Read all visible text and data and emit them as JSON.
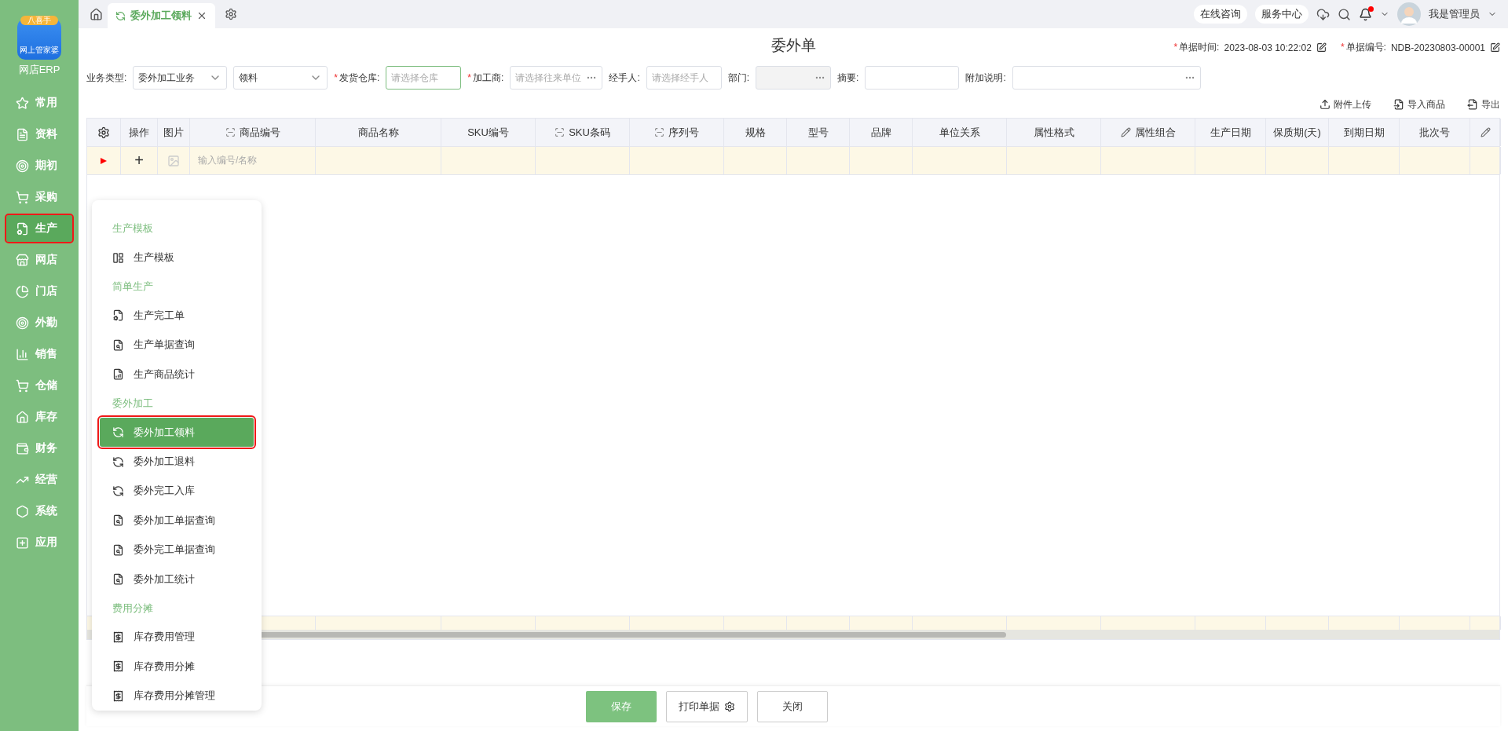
{
  "app": {
    "logo_badge": "八喜手",
    "logo_caption": "网上管家婆",
    "name": "网店ERP"
  },
  "sidebar": {
    "items": [
      {
        "label": "常用",
        "selected": false,
        "highlighted": false
      },
      {
        "label": "资料",
        "selected": false,
        "highlighted": false
      },
      {
        "label": "期初",
        "selected": false,
        "highlighted": false
      },
      {
        "label": "采购",
        "selected": false,
        "highlighted": false
      },
      {
        "label": "生产",
        "selected": true,
        "highlighted": true
      },
      {
        "label": "网店",
        "selected": false,
        "highlighted": false
      },
      {
        "label": "门店",
        "selected": false,
        "highlighted": false
      },
      {
        "label": "外勤",
        "selected": false,
        "highlighted": false
      },
      {
        "label": "销售",
        "selected": false,
        "highlighted": false
      },
      {
        "label": "仓储",
        "selected": false,
        "highlighted": false
      },
      {
        "label": "库存",
        "selected": false,
        "highlighted": false
      },
      {
        "label": "财务",
        "selected": false,
        "highlighted": false
      },
      {
        "label": "经营",
        "selected": false,
        "highlighted": false
      },
      {
        "label": "系统",
        "selected": false,
        "highlighted": false
      },
      {
        "label": "应用",
        "selected": false,
        "highlighted": false
      }
    ]
  },
  "tabs": [
    {
      "label": "委外加工领料",
      "selected": true
    }
  ],
  "header": {
    "links": [
      "在线咨询",
      "服务中心"
    ],
    "has_notification": true,
    "user": "我是管理员"
  },
  "form": {
    "title": "委外单",
    "meta": [
      {
        "required_mark": "*",
        "label": "单据时间:",
        "value": "2023-08-03 10:22:02"
      },
      {
        "required_mark": "*",
        "label": "单据编号:",
        "value": "NDB-20230803-00001"
      }
    ],
    "fields": [
      {
        "label": "业务类型:",
        "kind": "select",
        "value": "委外加工业务"
      },
      {
        "kind": "select",
        "value": "领料"
      },
      {
        "required_mark": "*",
        "label": "发货仓库:",
        "kind": "text",
        "placeholder": "请选择仓库",
        "focused": true
      },
      {
        "required_mark": "*",
        "label": "加工商:",
        "kind": "picker",
        "placeholder": "请选择往来单位"
      },
      {
        "label": "经手人:",
        "kind": "text",
        "placeholder": "请选择经手人"
      },
      {
        "label": "部门:",
        "kind": "picker",
        "disabled": true
      },
      {
        "label": "摘要:",
        "kind": "text"
      },
      {
        "label": "附加说明:",
        "kind": "picker"
      }
    ]
  },
  "toolbar": [
    "附件上传",
    "导入商品",
    "导出"
  ],
  "table": {
    "columns": [
      {
        "kind": "settings"
      },
      {
        "label": "操作",
        "kind": "plain"
      },
      {
        "label": "图片",
        "kind": "plain"
      },
      {
        "label": "商品编号",
        "kind": "scan"
      },
      {
        "label": "商品名称",
        "kind": "plain"
      },
      {
        "label": "SKU编号",
        "kind": "plain"
      },
      {
        "label": "SKU条码",
        "kind": "scan"
      },
      {
        "label": "序列号",
        "kind": "scan"
      },
      {
        "label": "规格",
        "kind": "plain"
      },
      {
        "label": "型号",
        "kind": "plain"
      },
      {
        "label": "品牌",
        "kind": "plain"
      },
      {
        "label": "单位关系",
        "kind": "plain"
      },
      {
        "label": "属性格式",
        "kind": "plain"
      },
      {
        "label": "属性组合",
        "kind": "edit"
      },
      {
        "label": "生产日期",
        "kind": "plain"
      },
      {
        "label": "保质期(天)",
        "kind": "plain"
      },
      {
        "label": "到期日期",
        "kind": "plain"
      },
      {
        "label": "批次号",
        "kind": "plain"
      },
      {
        "kind": "edit"
      }
    ],
    "input_row": {
      "add": "+",
      "placeholder": "输入编号/名称"
    }
  },
  "flyout": {
    "groups": [
      {
        "title": "生产模板",
        "items": [
          {
            "label": "生产模板",
            "selected": false,
            "highlighted": false
          }
        ]
      },
      {
        "title": "简单生产",
        "items": [
          {
            "label": "生产完工单",
            "selected": false,
            "highlighted": false
          },
          {
            "label": "生产单据查询",
            "selected": false,
            "highlighted": false
          },
          {
            "label": "生产商品统计",
            "selected": false,
            "highlighted": false
          }
        ]
      },
      {
        "title": "委外加工",
        "items": [
          {
            "label": "委外加工领料",
            "selected": true,
            "highlighted": true
          },
          {
            "label": "委外加工退料",
            "selected": false,
            "highlighted": false
          },
          {
            "label": "委外完工入库",
            "selected": false,
            "highlighted": false
          },
          {
            "label": "委外加工单据查询",
            "selected": false,
            "highlighted": false
          },
          {
            "label": "委外完工单据查询",
            "selected": false,
            "highlighted": false
          },
          {
            "label": "委外加工统计",
            "selected": false,
            "highlighted": false
          }
        ]
      },
      {
        "title": "费用分摊",
        "items": [
          {
            "label": "库存费用管理",
            "selected": false,
            "highlighted": false
          },
          {
            "label": "库存费用分摊",
            "selected": false,
            "highlighted": false
          },
          {
            "label": "库存费用分摊管理",
            "selected": false,
            "highlighted": false
          }
        ]
      }
    ]
  },
  "footer": [
    {
      "label": "保存",
      "kind": "primary"
    },
    {
      "label": "打印单据",
      "kind": "split"
    },
    {
      "label": "关闭",
      "kind": "plain"
    }
  ]
}
